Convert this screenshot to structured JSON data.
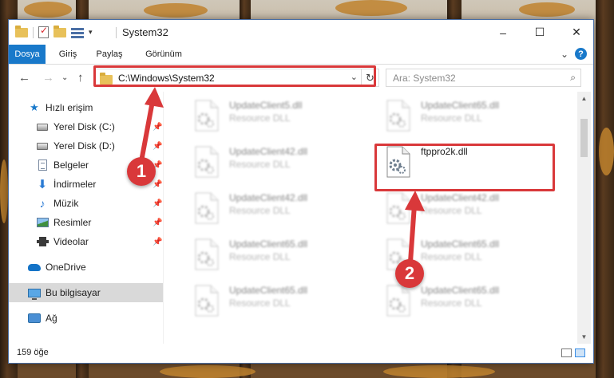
{
  "window": {
    "title": "System32",
    "controls": {
      "minimize": "–",
      "maximize": "☐",
      "close": "✕"
    }
  },
  "ribbon": {
    "tabs": [
      {
        "label": "Dosya",
        "active": true
      },
      {
        "label": "Giriş",
        "active": false
      },
      {
        "label": "Paylaş",
        "active": false
      },
      {
        "label": "Görünüm",
        "active": false
      }
    ],
    "expand": "⌄",
    "help": "?"
  },
  "navigation": {
    "back": "←",
    "forward": "→",
    "recent": "⌄",
    "up": "↑"
  },
  "address": {
    "path": "C:\\Windows\\System32",
    "dropdown": "⌄",
    "refresh": "↻"
  },
  "search": {
    "placeholder": "Ara: System32",
    "icon": "⌕"
  },
  "sidebar": {
    "items": [
      {
        "label": "Hızlı erişim",
        "icon": "star-icon",
        "pinned": false
      },
      {
        "label": "Yerel Disk (C:)",
        "icon": "drive-icon",
        "pinned": true
      },
      {
        "label": "Yerel Disk (D:)",
        "icon": "drive-icon",
        "pinned": true
      },
      {
        "label": "Belgeler",
        "icon": "document-icon",
        "pinned": true
      },
      {
        "label": "İndirmeler",
        "icon": "download-icon",
        "pinned": true
      },
      {
        "label": "Müzik",
        "icon": "music-icon",
        "pinned": true
      },
      {
        "label": "Resimler",
        "icon": "pictures-icon",
        "pinned": true
      },
      {
        "label": "Videolar",
        "icon": "video-icon",
        "pinned": true
      },
      {
        "label": "OneDrive",
        "icon": "cloud-icon",
        "pinned": false
      },
      {
        "label": "Bu bilgisayar",
        "icon": "computer-icon",
        "pinned": false,
        "selected": true
      },
      {
        "label": "Ağ",
        "icon": "network-icon",
        "pinned": false
      }
    ],
    "pin_glyph": "📌"
  },
  "files": [
    {
      "name": "UpdateClient5.dll",
      "desc": "Resource DLL",
      "blurred": true
    },
    {
      "name": "UpdateClient65.dll",
      "desc": "Resource DLL",
      "blurred": true
    },
    {
      "name": "UpdateClient42.dll",
      "desc": "Resource DLL",
      "blurred": true
    },
    {
      "name": "ftppro2k.dll",
      "desc": "",
      "blurred": false
    },
    {
      "name": "UpdateClient42.dll",
      "desc": "Resource DLL",
      "blurred": true
    },
    {
      "name": "UpdateClient42.dll",
      "desc": "Resource DLL",
      "blurred": true
    },
    {
      "name": "UpdateClient65.dll",
      "desc": "Resource DLL",
      "blurred": true
    },
    {
      "name": "UpdateClient65.dll",
      "desc": "Resource DLL",
      "blurred": true
    },
    {
      "name": "UpdateClient65.dll",
      "desc": "Resource DLL",
      "blurred": true
    },
    {
      "name": "UpdateClient65.dll",
      "desc": "Resource DLL",
      "blurred": true
    }
  ],
  "status": {
    "count": "159 öğe"
  },
  "annotations": {
    "marker1": "1",
    "marker2": "2",
    "color": "#d9383a"
  },
  "colors": {
    "accent": "#1979ca",
    "selection": "#d9d9d9"
  }
}
